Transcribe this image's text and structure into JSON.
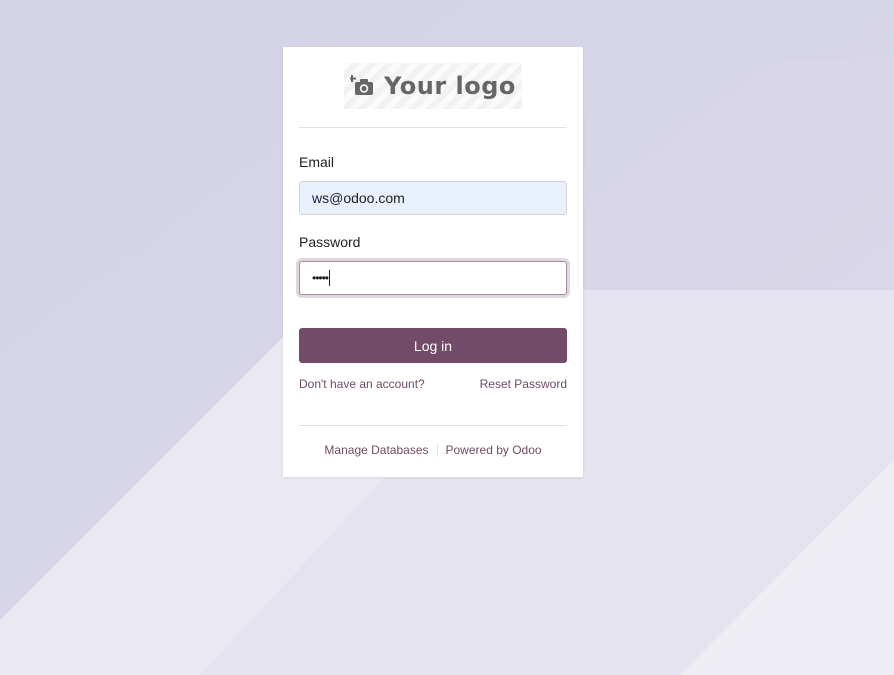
{
  "logo": {
    "text": "Your logo",
    "icon": "camera-plus-icon"
  },
  "form": {
    "email_label": "Email",
    "email_value": "ws@odoo.com",
    "password_label": "Password",
    "password_mask": "•••••",
    "login_label": "Log in"
  },
  "links": {
    "signup": "Don't have an account?",
    "reset": "Reset Password"
  },
  "footer": {
    "manage": "Manage Databases",
    "powered": "Powered by Odoo"
  },
  "colors": {
    "brand": "#714b67",
    "email_fill": "#e8f0fe",
    "logo_text": "#666666"
  }
}
